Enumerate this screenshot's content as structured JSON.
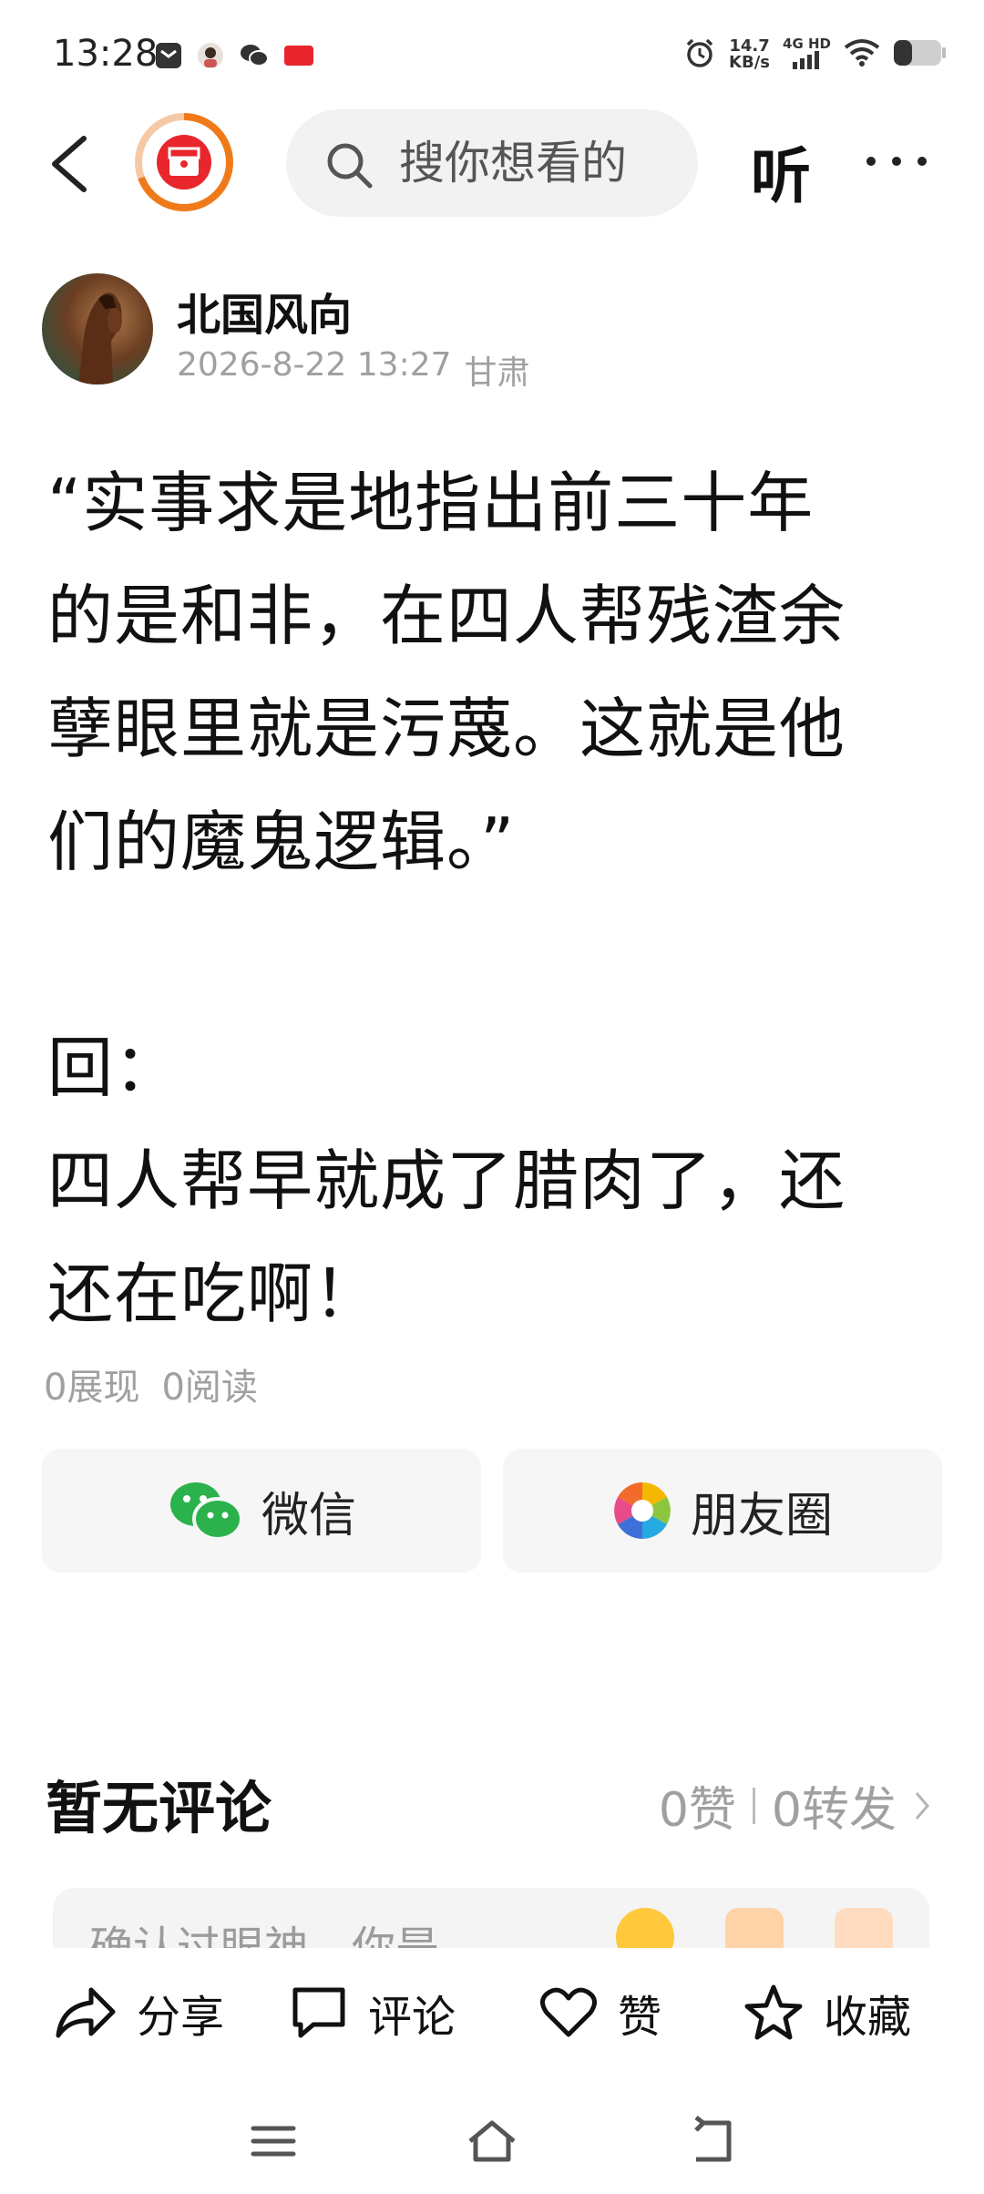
{
  "status_bar": {
    "time": "13:28",
    "badge_label": "头条",
    "speed_value": "14.7",
    "speed_unit": "KB/s",
    "network": "4G HD",
    "icons": [
      "message-icon",
      "avatar-notification-icon",
      "wechat-icon",
      "toutiao-badge-icon",
      "alarm-icon",
      "signal-icon",
      "wifi-icon",
      "battery-icon"
    ]
  },
  "nav": {
    "search_placeholder": "搜你想看的",
    "listen_label": "听",
    "more_label": "···",
    "accent_color": "#f07a1a",
    "logo_color": "#e8262c"
  },
  "author": {
    "name": "北国风向",
    "date": "2026-8-22 13:27",
    "location": "甘肃"
  },
  "article": {
    "lines": [
      "“实事求是地指出前三十年",
      "的是和非，在四人帮残渣余",
      "孽眼里就是污蔑。这就是他",
      "们的魔鬼逻辑。”",
      "回：",
      "四人帮早就成了腊肉了，还",
      "还在吃啊！"
    ]
  },
  "stats": {
    "impressions": "0展现",
    "reads": "0阅读"
  },
  "share": {
    "wechat_label": "微信",
    "moments_label": "朋友圈"
  },
  "comments": {
    "title": "暂无评论",
    "likes": "0赞",
    "forwards": "0转发",
    "quick_text": "确认过眼神，你是…"
  },
  "actions": {
    "share": "分享",
    "comment": "评论",
    "like": "赞",
    "favorite": "收藏"
  }
}
